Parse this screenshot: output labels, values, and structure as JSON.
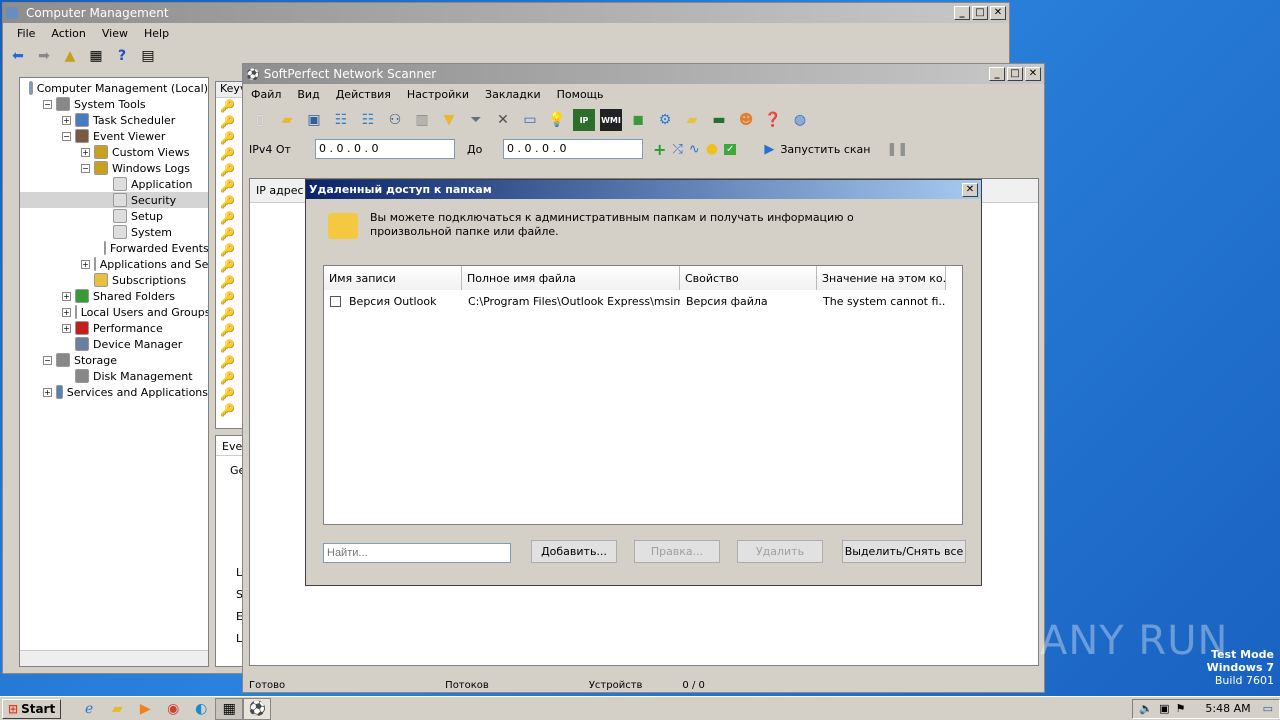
{
  "cm": {
    "title": "Computer Management",
    "menu": [
      "File",
      "Action",
      "View",
      "Help"
    ],
    "tree": [
      {
        "label": "Computer Management (Local)",
        "indent": 0,
        "exp": ""
      },
      {
        "label": "System Tools",
        "indent": 1,
        "exp": "−"
      },
      {
        "label": "Task Scheduler",
        "indent": 2,
        "exp": "+"
      },
      {
        "label": "Event Viewer",
        "indent": 2,
        "exp": "−"
      },
      {
        "label": "Custom Views",
        "indent": 3,
        "exp": "+"
      },
      {
        "label": "Windows Logs",
        "indent": 3,
        "exp": "−"
      },
      {
        "label": "Application",
        "indent": 4,
        "exp": ""
      },
      {
        "label": "Security",
        "indent": 4,
        "exp": ""
      },
      {
        "label": "Setup",
        "indent": 4,
        "exp": ""
      },
      {
        "label": "System",
        "indent": 4,
        "exp": ""
      },
      {
        "label": "Forwarded Events",
        "indent": 4,
        "exp": ""
      },
      {
        "label": "Applications and Servi",
        "indent": 3,
        "exp": "+"
      },
      {
        "label": "Subscriptions",
        "indent": 3,
        "exp": ""
      },
      {
        "label": "Shared Folders",
        "indent": 2,
        "exp": "+"
      },
      {
        "label": "Local Users and Groups",
        "indent": 2,
        "exp": "+"
      },
      {
        "label": "Performance",
        "indent": 2,
        "exp": "+"
      },
      {
        "label": "Device Manager",
        "indent": 2,
        "exp": ""
      },
      {
        "label": "Storage",
        "indent": 1,
        "exp": "−"
      },
      {
        "label": "Disk Management",
        "indent": 2,
        "exp": ""
      },
      {
        "label": "Services and Applications",
        "indent": 1,
        "exp": "+"
      }
    ],
    "list_header": "Keyv",
    "pane_tab": "Even",
    "pane_label": "Ge",
    "pane_letters": [
      "L",
      "S",
      "E",
      "L"
    ]
  },
  "ns": {
    "title": "SoftPerfect Network Scanner",
    "menu": [
      "Файл",
      "Вид",
      "Действия",
      "Настройки",
      "Закладки",
      "Помощь"
    ],
    "ipv4_label": "IPv4 От",
    "ip_from": "0 . 0 . 0 . 0",
    "to_label": "До",
    "ip_to": "0 . 0 . 0 . 0",
    "scan_label": "Запустить скан",
    "col_ip": "IP адрес",
    "status": [
      "Готово",
      "Потоков",
      "Устройств",
      "0 / 0"
    ]
  },
  "dlg": {
    "title": "Удаленный доступ к папкам",
    "info": "Вы можете подключаться к административным папкам и получать информацию о произвольной папке или файле.",
    "columns": [
      "Имя записи",
      "Полное имя файла",
      "Свойство",
      "Значение на этом ко..."
    ],
    "rows": [
      {
        "name": "Версия Outlook",
        "file": "C:\\Program Files\\Outlook Express\\msim...",
        "prop": "Версия файла",
        "value": "The system cannot fi..."
      }
    ],
    "search_placeholder": "Найти...",
    "btn_add": "Добавить...",
    "btn_edit": "Правка...",
    "btn_delete": "Удалить",
    "btn_select": "Выделить/Снять все"
  },
  "desktop": {
    "watermark": "ANY RUN",
    "test_mode": [
      "Test Mode",
      "Windows 7",
      "Build 7601"
    ]
  },
  "taskbar": {
    "start": "Start",
    "time": "5:48 AM"
  }
}
